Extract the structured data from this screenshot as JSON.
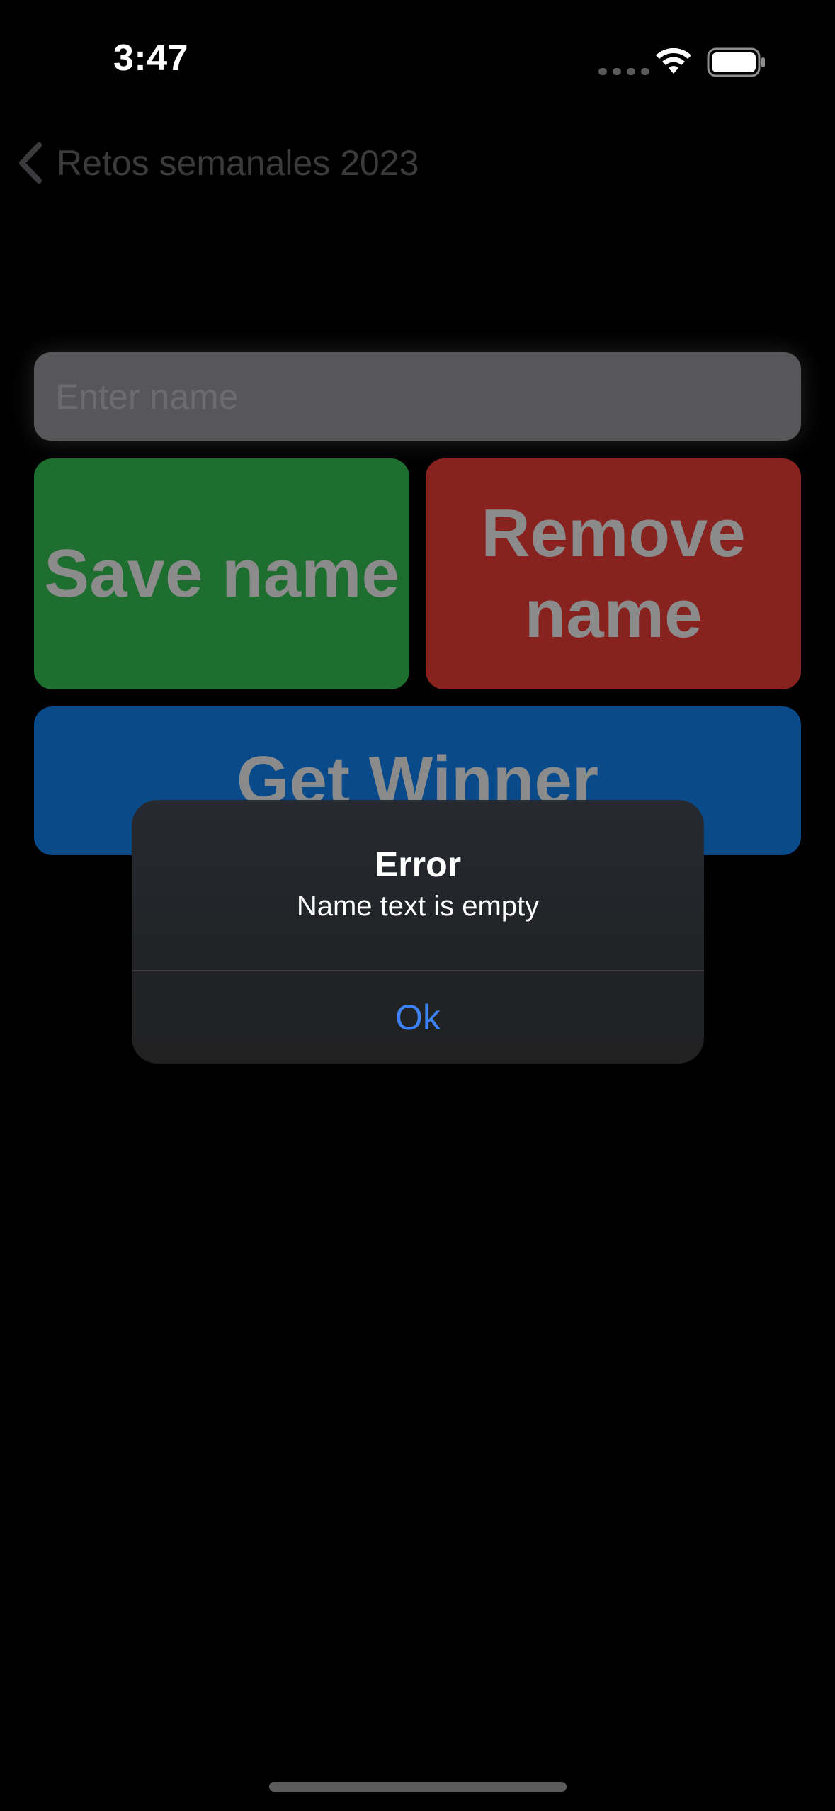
{
  "status_bar": {
    "time": "3:47",
    "icons": [
      "cellular-signal-icon",
      "wifi-icon",
      "battery-icon"
    ]
  },
  "nav": {
    "back_label": "Retos semanales 2023",
    "back_icon": "chevron-left-icon"
  },
  "form": {
    "name_placeholder": "Enter name",
    "name_value": ""
  },
  "buttons": {
    "save_label": "Save name",
    "remove_label": "Remove name",
    "winner_label": "Get Winner"
  },
  "alert": {
    "title": "Error",
    "message": "Name text is empty",
    "ok_label": "Ok"
  },
  "colors": {
    "background": "#000000",
    "save": "#1d6e2f",
    "remove": "#87221f",
    "winner": "#084a8a",
    "alert_bg": "#232427",
    "accent": "#3c82f6"
  }
}
